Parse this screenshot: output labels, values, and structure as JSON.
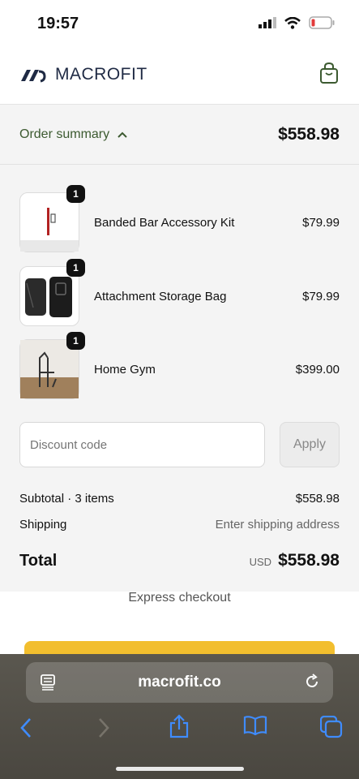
{
  "status_bar": {
    "time": "19:57"
  },
  "header": {
    "brand": "MACROFIT"
  },
  "summary": {
    "label": "Order summary",
    "total": "$558.98"
  },
  "items": [
    {
      "name": "Banded Bar Accessory Kit",
      "price": "$79.99",
      "qty": "1"
    },
    {
      "name": "Attachment Storage Bag",
      "price": "$79.99",
      "qty": "1"
    },
    {
      "name": "Home Gym",
      "price": "$399.00",
      "qty": "1"
    }
  ],
  "discount": {
    "placeholder": "Discount code",
    "apply": "Apply"
  },
  "subtotal": {
    "label": "Subtotal · 3 items",
    "value": "$558.98"
  },
  "shipping": {
    "label": "Shipping",
    "value": "Enter shipping address"
  },
  "total": {
    "label": "Total",
    "currency": "USD",
    "value": "$558.98"
  },
  "express": {
    "label": "Express checkout"
  },
  "browser": {
    "url": "macrofit.co"
  },
  "colors": {
    "accent_green": "#3c5a30",
    "pay_button": "#f2be2e",
    "toolbar_icons": "#3f8cff"
  }
}
